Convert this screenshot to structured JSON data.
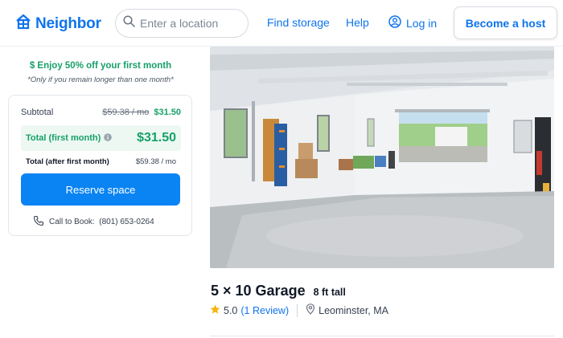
{
  "header": {
    "logo_text": "Neighbor",
    "search_placeholder": "Enter a location",
    "nav": {
      "find_storage": "Find storage",
      "help": "Help",
      "login": "Log in",
      "become_host": "Become a host"
    }
  },
  "promo": {
    "headline": "$ Enjoy 50% off your first month",
    "note": "*Only if you remain longer than one month*"
  },
  "pricing": {
    "subtotal_label": "Subtotal",
    "subtotal_original": "$59.38 / mo",
    "subtotal_discounted": "$31.50",
    "total_first_label": "Total (first month)",
    "total_first_amount": "$31.50",
    "total_after_label": "Total (after first month)",
    "total_after_amount": "$59.38 / mo",
    "reserve_label": "Reserve space",
    "call_text": "Call to Book:  (801) 653-0264"
  },
  "listing": {
    "title": "5 × 10 Garage",
    "height": "8 ft tall",
    "rating": "5.0",
    "reviews": "(1 Review)",
    "location": "Leominster, MA"
  },
  "colors": {
    "brand_blue": "#0f74ee",
    "button_blue": "#0b84f3",
    "promo_green": "#17a06a",
    "total_bg": "#ecf8f1"
  }
}
